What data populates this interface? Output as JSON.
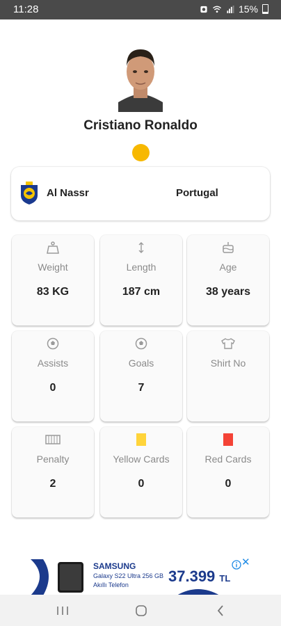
{
  "status_bar": {
    "time": "11:28",
    "battery": "15%"
  },
  "player": {
    "name": "Cristiano Ronaldo",
    "status_color": "#f7b800"
  },
  "club": {
    "name": "Al Nassr",
    "country": "Portugal"
  },
  "stats": [
    {
      "label": "Weight",
      "value": "83 KG",
      "icon": "weight-icon"
    },
    {
      "label": "Length",
      "value": "187 cm",
      "icon": "height-icon"
    },
    {
      "label": "Age",
      "value": "38 years",
      "icon": "cake-icon"
    },
    {
      "label": "Assists",
      "value": "0",
      "icon": "soccer-ball-icon"
    },
    {
      "label": "Goals",
      "value": "7",
      "icon": "soccer-ball-icon"
    },
    {
      "label": "Shirt No",
      "value": "",
      "icon": "shirt-icon"
    },
    {
      "label": "Penalty",
      "value": "2",
      "icon": "goal-net-icon"
    },
    {
      "label": "Yellow Cards",
      "value": "0",
      "icon": "yellow-card-icon"
    },
    {
      "label": "Red Cards",
      "value": "0",
      "icon": "red-card-icon"
    }
  ],
  "ad": {
    "brand": "SAMSUNG",
    "product": "Galaxy S22 Ultra 256 GB",
    "subtitle": "Akıllı Telefon",
    "price": "37.399",
    "currency": "TL"
  },
  "colors": {
    "yellow_card": "#ffd43a",
    "red_card": "#f44336",
    "ad_blue": "#1b3a8c"
  }
}
